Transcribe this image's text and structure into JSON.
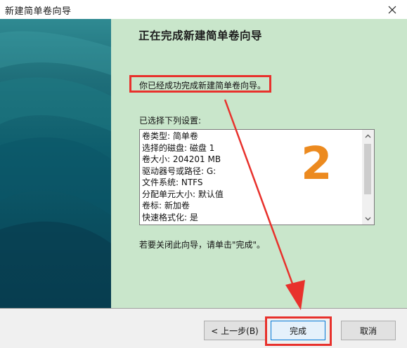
{
  "window": {
    "title": "新建简单卷向导",
    "close_glyph": "✕"
  },
  "main": {
    "heading": "正在完成新建简单卷向导",
    "completed_text": "你已经成功完成新建简单卷向导。",
    "settings_label": "已选择下列设置:",
    "settings": [
      "卷类型: 简单卷",
      "选择的磁盘: 磁盘 1",
      "卷大小: 204201 MB",
      "驱动器号或路径: G:",
      "文件系统: NTFS",
      "分配单元大小: 默认值",
      "卷标: 新加卷",
      "快速格式化: 是"
    ],
    "close_hint": "若要关闭此向导，请单击\"完成\"。",
    "annotation_number": "2"
  },
  "buttons": {
    "back": "< 上一步(B)",
    "finish": "完成",
    "cancel": "取消"
  },
  "colors": {
    "annotation_red": "#e8312c",
    "annotation_orange": "#ec8a1f",
    "content_bg": "#c9e6cb",
    "panel_teal": "#0e5e6d"
  },
  "icons": {
    "close": "close-icon",
    "scroll_up": "chevron-up-icon",
    "scroll_down": "chevron-down-icon"
  }
}
